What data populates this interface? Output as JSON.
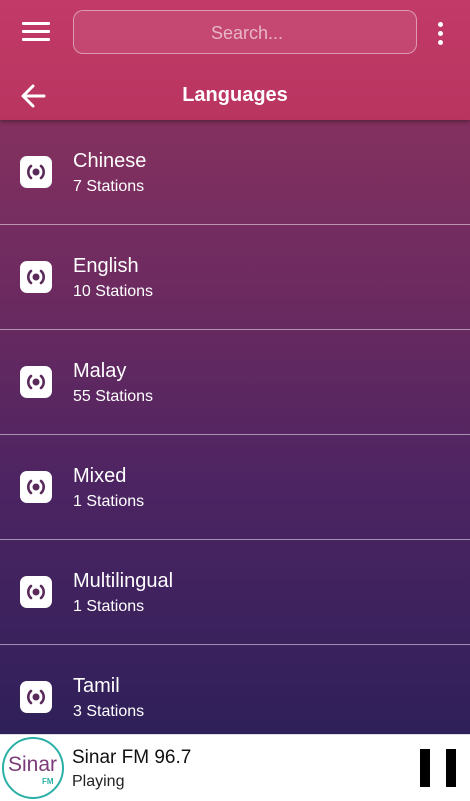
{
  "header": {
    "search_placeholder": "Search...",
    "title": "Languages",
    "menu_icon": "hamburger-menu-icon",
    "more_icon": "more-vertical-icon",
    "back_icon": "arrow-left-icon",
    "color_top": "#c23a68"
  },
  "languages": [
    {
      "name": "Chinese",
      "count": "7 Stations"
    },
    {
      "name": "English",
      "count": "10 Stations"
    },
    {
      "name": "Malay",
      "count": "55 Stations"
    },
    {
      "name": "Mixed",
      "count": "1 Stations"
    },
    {
      "name": "Multilingual",
      "count": "1 Stations"
    },
    {
      "name": "Tamil",
      "count": "3 Stations"
    }
  ],
  "player": {
    "logo_text": "Sinar",
    "logo_sub": "FM",
    "station": "Sinar FM 96.7",
    "status": "Playing",
    "pause_icon": "pause-icon"
  }
}
